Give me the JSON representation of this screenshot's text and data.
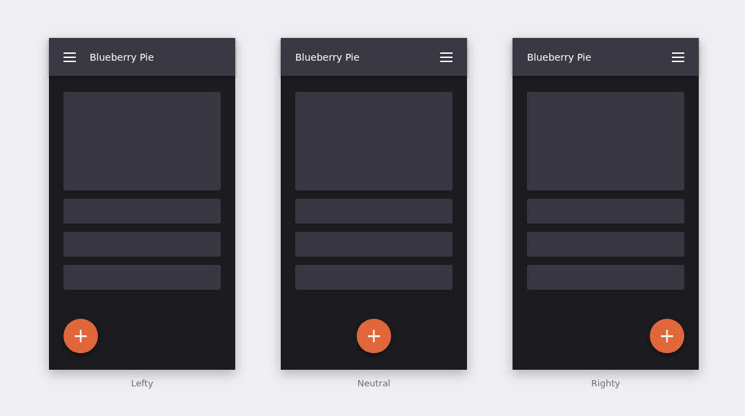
{
  "phones": [
    {
      "kind": "lefty",
      "title": "Blueberry Pie",
      "fab_symbol": "+",
      "caption": "Lefty"
    },
    {
      "kind": "neutral",
      "title": "Blueberry Pie",
      "fab_symbol": "+",
      "caption": "Neutral"
    },
    {
      "kind": "righty",
      "title": "Blueberry Pie",
      "fab_symbol": "+",
      "caption": "Righty"
    }
  ]
}
